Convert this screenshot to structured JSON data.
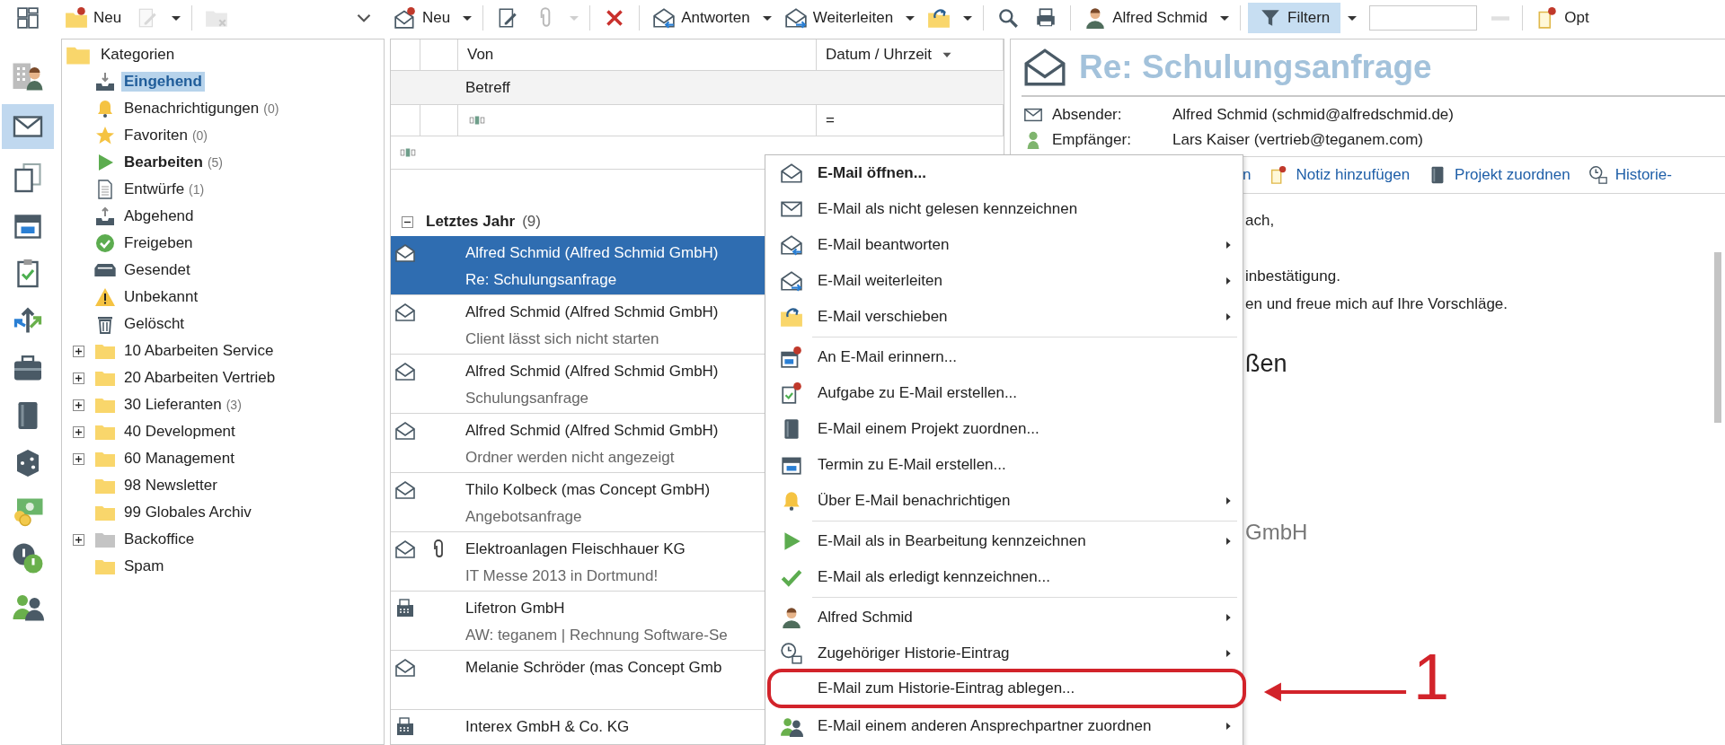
{
  "toolbar": {
    "tree_tools": [
      {
        "kind": "button",
        "disabled": false,
        "selected": false
      },
      {
        "kind": "button",
        "label": "Neu",
        "disabled": false,
        "selected": false
      },
      {
        "kind": "button",
        "disabled": true,
        "selected": false
      },
      {
        "kind": "caret",
        "disabled": false
      },
      {
        "kind": "separator"
      },
      {
        "kind": "button",
        "disabled": true,
        "selected": false
      },
      {
        "kind": "button",
        "disabled": false,
        "selected": false
      }
    ],
    "mail_tools": [
      {
        "kind": "button",
        "label": "Neu",
        "disabled": false,
        "selected": false
      },
      {
        "kind": "caret",
        "disabled": false
      },
      {
        "kind": "separator"
      },
      {
        "kind": "button",
        "disabled": false,
        "selected": false
      },
      {
        "kind": "button",
        "disabled": true,
        "selected": false
      },
      {
        "kind": "caret",
        "disabled": true
      },
      {
        "kind": "separator"
      },
      {
        "kind": "button",
        "disabled": false,
        "selected": false
      },
      {
        "kind": "separator"
      },
      {
        "kind": "button",
        "label": "Antworten",
        "disabled": false,
        "selected": false
      },
      {
        "kind": "caret",
        "disabled": false
      },
      {
        "kind": "button",
        "label": "Weiterleiten",
        "disabled": false,
        "selected": false
      },
      {
        "kind": "caret",
        "disabled": false
      },
      {
        "kind": "button",
        "disabled": false,
        "selected": false
      },
      {
        "kind": "caret",
        "disabled": false
      },
      {
        "kind": "separator"
      },
      {
        "kind": "button",
        "disabled": false,
        "selected": false
      },
      {
        "kind": "button",
        "disabled": false,
        "selected": false
      },
      {
        "kind": "separator"
      },
      {
        "kind": "button",
        "label": "Alfred Schmid",
        "disabled": false,
        "selected": false
      },
      {
        "kind": "caret",
        "disabled": false
      },
      {
        "kind": "separator"
      },
      {
        "kind": "button",
        "label": "Filtern",
        "disabled": false,
        "selected": true
      },
      {
        "kind": "caret",
        "disabled": false
      },
      {
        "kind": "field"
      },
      {
        "kind": "button",
        "disabled": true,
        "selected": false
      },
      {
        "kind": "separator"
      },
      {
        "kind": "button",
        "label": "Opt",
        "disabled": false,
        "selected": false
      }
    ]
  },
  "rail": [
    {
      "selected": false
    },
    {
      "selected": true
    },
    {
      "selected": false
    },
    {
      "selected": false
    },
    {
      "selected": false
    },
    {
      "selected": false
    },
    {
      "selected": false
    },
    {
      "selected": false
    },
    {
      "selected": false
    },
    {
      "selected": false
    },
    {
      "selected": false
    },
    {
      "selected": false
    }
  ],
  "tree": {
    "label": "Kategorien",
    "children": [
      {
        "label": "Eingehend",
        "bold": true,
        "selected": true,
        "collapsed": false
      },
      {
        "label": "Benachrichtigungen",
        "count": "(0)",
        "bold": false,
        "selected": false,
        "collapsed": false
      },
      {
        "label": "Favoriten",
        "count": "(0)",
        "bold": false,
        "selected": false,
        "collapsed": false
      },
      {
        "label": "Bearbeiten",
        "count": "(5)",
        "bold": true,
        "selected": false,
        "collapsed": false
      },
      {
        "label": "Entwürfe",
        "count": "(1)",
        "bold": false,
        "selected": false,
        "collapsed": false
      },
      {
        "label": "Abgehend",
        "bold": false,
        "selected": false,
        "collapsed": false
      },
      {
        "label": "Freigeben",
        "bold": false,
        "selected": false,
        "collapsed": false
      },
      {
        "label": "Gesendet",
        "bold": false,
        "selected": false,
        "collapsed": false
      },
      {
        "label": "Unbekannt",
        "bold": false,
        "selected": false,
        "collapsed": false
      },
      {
        "label": "Gelöscht",
        "bold": false,
        "selected": false,
        "collapsed": false
      },
      {
        "label": "10 Abarbeiten Service",
        "bold": false,
        "selected": false,
        "collapsed": true
      },
      {
        "label": "20 Abarbeiten Vertrieb",
        "bold": false,
        "selected": false,
        "collapsed": true
      },
      {
        "label": "30 Lieferanten",
        "count": "(3)",
        "bold": false,
        "selected": false,
        "collapsed": true
      },
      {
        "label": "40 Development",
        "bold": false,
        "selected": false,
        "collapsed": true
      },
      {
        "label": "60 Management",
        "bold": false,
        "selected": false,
        "collapsed": true
      },
      {
        "label": "98 Newsletter",
        "bold": false,
        "selected": false,
        "collapsed": false
      },
      {
        "label": "99 Globales Archiv",
        "bold": false,
        "selected": false,
        "collapsed": false
      },
      {
        "label": "Backoffice",
        "bold": false,
        "selected": false,
        "collapsed": true
      },
      {
        "label": "Spam",
        "bold": false,
        "selected": false,
        "collapsed": false
      }
    ]
  },
  "mail_list": {
    "columns": {
      "from": "Von",
      "subject": "Betreff",
      "date": "Datum / Uhrzeit",
      "date_sorted": true
    },
    "filter_date": "=",
    "group": {
      "label": "Letztes Jahr",
      "count": "(9)",
      "expanded": true
    },
    "rows": [
      {
        "kind": "email",
        "from": "Alfred Schmid (Alfred Schmid GmbH)",
        "subject": "Re: Schulungsanfrage",
        "attachment": false,
        "selected": true
      },
      {
        "kind": "email",
        "from": "Alfred Schmid (Alfred Schmid GmbH)",
        "subject": "Client lässt sich nicht starten",
        "attachment": false,
        "selected": false
      },
      {
        "kind": "email",
        "from": "Alfred Schmid (Alfred Schmid GmbH)",
        "subject": "Schulungsanfrage",
        "attachment": false,
        "selected": false
      },
      {
        "kind": "email",
        "from": "Alfred Schmid (Alfred Schmid GmbH)",
        "subject": "Ordner werden nicht angezeigt",
        "attachment": false,
        "selected": false
      },
      {
        "kind": "email",
        "from": "Thilo Kolbeck (mas Concept GmbH)",
        "subject": "Angebotsanfrage",
        "attachment": false,
        "selected": false
      },
      {
        "kind": "email",
        "from": "Elektroanlagen Fleischhauer KG",
        "subject": "IT Messe 2013 in Dortmund!",
        "attachment": true,
        "selected": false
      },
      {
        "kind": "fax",
        "from": "Lifetron GmbH",
        "subject": "AW: teganem | Rechnung Software-Se",
        "attachment": false,
        "selected": false
      },
      {
        "kind": "email",
        "from": "Melanie Schröder (mas Concept Gmb",
        "attachment": false,
        "selected": false
      },
      {
        "kind": "fax",
        "from": "Interex GmbH & Co. KG",
        "attachment": false,
        "selected": false
      }
    ]
  },
  "reading_pane": {
    "title": "Re: Schulungsanfrage",
    "fields": [
      {
        "label": "Absender:",
        "value": "Alfred Schmid (schmid@alfredschmid.de)"
      },
      {
        "label": "Empfänger:",
        "value": "Lars Kaiser (vertrieb@teganem.com)"
      }
    ],
    "actions": [
      "n",
      "Notiz hinzufügen",
      "Projekt zuordnen",
      "Historie-"
    ],
    "body": [
      {
        "kind": "greeting",
        "text": "ach,"
      },
      {
        "kind": "line",
        "text": "inbestätigung."
      },
      {
        "kind": "line",
        "text": "en und freue mich auf Ihre Vorschläge."
      },
      {
        "kind": "closing",
        "text": "ßen"
      },
      {
        "kind": "signature",
        "text": "GmbH"
      }
    ]
  },
  "context_menu": {
    "items": [
      {
        "kind": "item",
        "label": "E-Mail öffnen...",
        "bold": true,
        "submenu": false,
        "marked": false
      },
      {
        "kind": "item",
        "label": "E-Mail als nicht gelesen kennzeichnen",
        "bold": false,
        "submenu": false,
        "marked": false
      },
      {
        "kind": "item",
        "label": "E-Mail beantworten",
        "bold": false,
        "submenu": true,
        "marked": false
      },
      {
        "kind": "item",
        "label": "E-Mail weiterleiten",
        "bold": false,
        "submenu": true,
        "marked": false
      },
      {
        "kind": "item",
        "label": "E-Mail verschieben",
        "bold": false,
        "submenu": true,
        "marked": false
      },
      {
        "kind": "separator"
      },
      {
        "kind": "item",
        "label": "An E-Mail erinnern...",
        "bold": false,
        "submenu": false,
        "marked": false
      },
      {
        "kind": "item",
        "label": "Aufgabe zu E-Mail erstellen...",
        "bold": false,
        "submenu": false,
        "marked": false
      },
      {
        "kind": "item",
        "label": "E-Mail einem Projekt zuordnen...",
        "bold": false,
        "submenu": false,
        "marked": false
      },
      {
        "kind": "item",
        "label": "Termin zu E-Mail erstellen...",
        "bold": false,
        "submenu": false,
        "marked": false
      },
      {
        "kind": "item",
        "label": "Über E-Mail benachrichtigen",
        "bold": false,
        "submenu": true,
        "marked": false
      },
      {
        "kind": "separator"
      },
      {
        "kind": "item",
        "label": "E-Mail als in Bearbeitung kennzeichnen",
        "bold": false,
        "submenu": true,
        "marked": false
      },
      {
        "kind": "item",
        "label": "E-Mail als erledigt kennzeichnen...",
        "bold": false,
        "submenu": false,
        "marked": false
      },
      {
        "kind": "separator"
      },
      {
        "kind": "item",
        "label": "Alfred Schmid",
        "bold": false,
        "submenu": true,
        "marked": false
      },
      {
        "kind": "item",
        "label": "Zugehöriger Historie-Eintrag",
        "bold": false,
        "submenu": true,
        "marked": false
      },
      {
        "kind": "item",
        "label": "E-Mail zum Historie-Eintrag ablegen...",
        "bold": false,
        "submenu": false,
        "marked": true
      },
      {
        "kind": "item",
        "label": "E-Mail einem anderen Ansprechpartner zuordnen",
        "bold": false,
        "submenu": true,
        "marked": false
      }
    ]
  },
  "annotation": {
    "label": "1"
  }
}
